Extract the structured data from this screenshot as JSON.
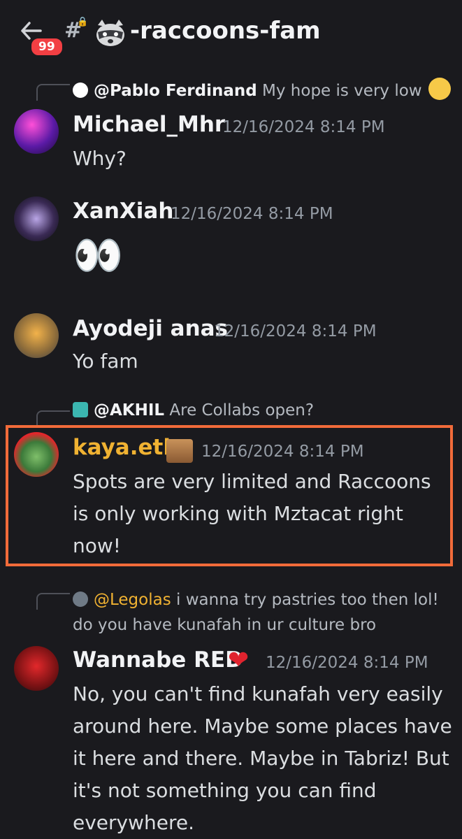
{
  "header": {
    "unread_badge": "99",
    "channel_name": "-raccoons-fam",
    "icons": [
      "back-arrow-icon",
      "hashtag-lock-icon",
      "raccoon-emoji-icon"
    ]
  },
  "messages": [
    {
      "reply": {
        "mention": "@Pablo Ferdinand",
        "text": "My hope is very low"
      },
      "username": "Michael_Mhr",
      "timestamp": "12/16/2024 8:14 PM",
      "text": "Why?"
    },
    {
      "username": "XanXiah",
      "timestamp": "12/16/2024 8:14 PM",
      "text": "👀"
    },
    {
      "username": "Ayodeji anas",
      "timestamp": "12/16/2024 8:14 PM",
      "text": "Yo fam"
    },
    {
      "reply": {
        "mention": "@AKHIL",
        "text": "Are Collabs open?"
      },
      "username": "kaya.eth",
      "username_color": "#f0b232",
      "timestamp": "12/16/2024 8:14 PM",
      "text": "Spots are very limited and Raccoons is only working with Mztacat right now!",
      "highlighted": true
    },
    {
      "reply": {
        "mention": "@Legolas",
        "text": "i wanna try pastries too then lol! do you have kunafah in ur culture bro"
      },
      "username": "Wannabe RED",
      "timestamp": "12/16/2024 8:14 PM",
      "text": "No, you can't find kunafah very easily around here. Maybe some places have it here and there. Maybe in Tabriz! But it's not something you can find everywhere."
    }
  ],
  "colors": {
    "background": "#1a1a1e",
    "highlight_border": "#f26b3a",
    "badge": "#f23f43",
    "mention_yellow": "#f0b232"
  }
}
